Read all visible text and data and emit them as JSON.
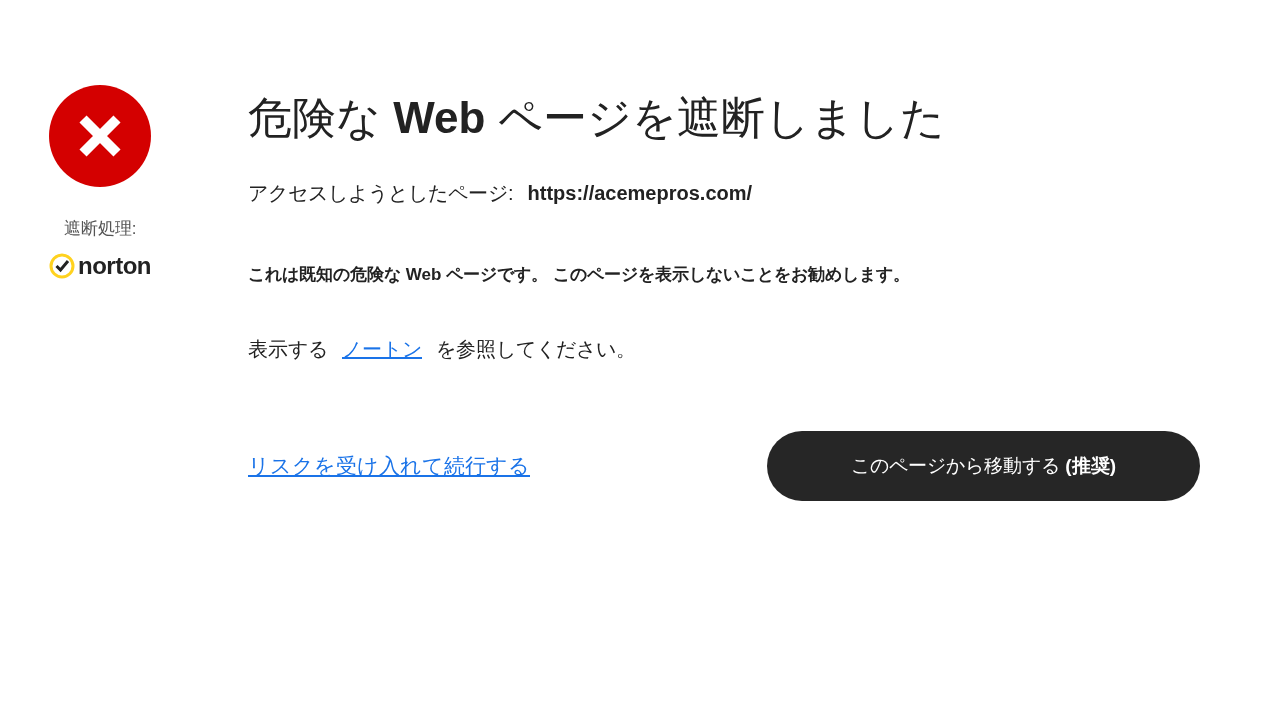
{
  "sidebar": {
    "blocked_by_label": "遮断処理:",
    "brand": "norton"
  },
  "title": "危険な **Web** ページを遮断しました",
  "access": {
    "label": "アクセスしようとしたページ:",
    "url": "https://acemepros.com/"
  },
  "warning": "これは既知の危険な Web ページです。 このページを表示しないことをお勧めします。",
  "info": {
    "before": "表示する",
    "link": "ノートン",
    "after": "を参照してください。"
  },
  "actions": {
    "proceed_link": "リスクを受け入れて続行する",
    "leave_button": "このページから移動する **(推奨)**"
  }
}
